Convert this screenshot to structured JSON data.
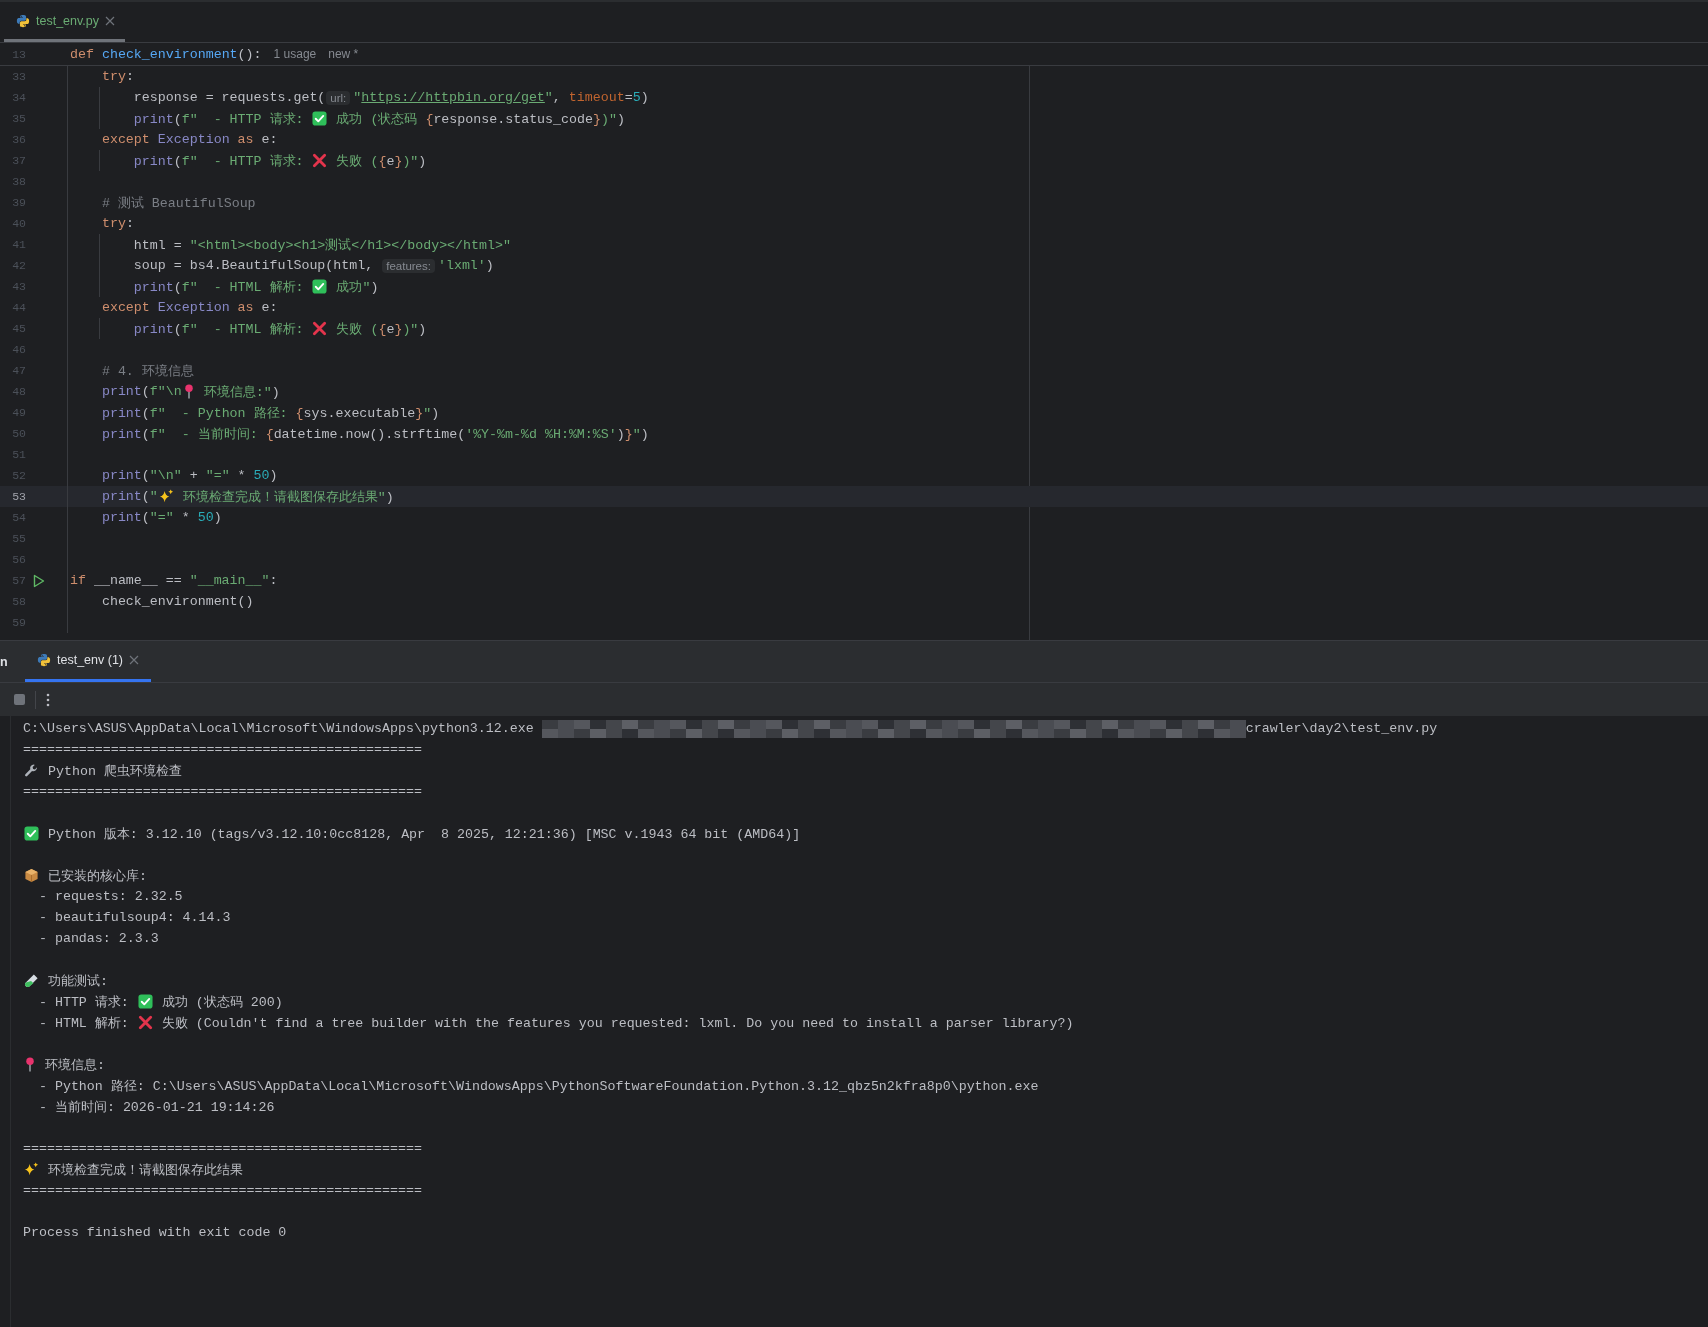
{
  "editor_tabs": [
    {
      "label": "test_env.py",
      "selected": true
    }
  ],
  "editor": {
    "sticky_line": {
      "no": "13",
      "parts": [
        {
          "kind": "code",
          "text": "def check_environment():"
        },
        {
          "kind": "lens",
          "text": "1 usage"
        },
        {
          "kind": "lens",
          "text": "new *"
        }
      ]
    },
    "lines": [
      {
        "no": "33",
        "current": false,
        "run": false,
        "parts": [
          {
            "kind": "code",
            "text": "    try:"
          }
        ]
      },
      {
        "no": "34",
        "current": false,
        "run": false,
        "parts": [
          {
            "kind": "code",
            "text": "        response = requests.get("
          },
          {
            "kind": "hint",
            "text": "url:"
          },
          {
            "kind": "code",
            "text": "\""
          },
          {
            "kind": "link",
            "text": "https://httpbin.org/get"
          },
          {
            "kind": "code",
            "text": "\", timeout=5)"
          }
        ]
      },
      {
        "no": "35",
        "current": false,
        "run": false,
        "parts": [
          {
            "kind": "code",
            "text": "        print(f\"  - HTTP 请求: "
          },
          {
            "kind": "check"
          },
          {
            "kind": "code",
            "text": " 成功 (状态码 {response.status_code})\")"
          }
        ]
      },
      {
        "no": "36",
        "current": false,
        "run": false,
        "parts": [
          {
            "kind": "code",
            "text": "    except Exception as e:"
          }
        ]
      },
      {
        "no": "37",
        "current": false,
        "run": false,
        "parts": [
          {
            "kind": "code",
            "text": "        print(f\"  - HTTP 请求: "
          },
          {
            "kind": "cross"
          },
          {
            "kind": "code",
            "text": " 失败 ({e})\")"
          }
        ]
      },
      {
        "no": "38",
        "current": false,
        "run": false
      },
      {
        "no": "39",
        "current": false,
        "run": false,
        "parts": [
          {
            "kind": "code",
            "text": "    # 测试 BeautifulSoup"
          }
        ]
      },
      {
        "no": "40",
        "current": false,
        "run": false,
        "parts": [
          {
            "kind": "code",
            "text": "    try:"
          }
        ]
      },
      {
        "no": "41",
        "current": false,
        "run": false,
        "parts": [
          {
            "kind": "code",
            "text": "        html = \"<html><body><h1>测试</h1></body></html>\""
          }
        ]
      },
      {
        "no": "42",
        "current": false,
        "run": false,
        "parts": [
          {
            "kind": "code",
            "text": "        soup = bs4.BeautifulSoup(html, "
          },
          {
            "kind": "hint",
            "text": "features:"
          },
          {
            "kind": "code",
            "text": "'lxml')"
          }
        ]
      },
      {
        "no": "43",
        "current": false,
        "run": false,
        "parts": [
          {
            "kind": "code",
            "text": "        print(f\"  - HTML 解析: "
          },
          {
            "kind": "check"
          },
          {
            "kind": "code",
            "text": " 成功\")"
          }
        ]
      },
      {
        "no": "44",
        "current": false,
        "run": false,
        "parts": [
          {
            "kind": "code",
            "text": "    except Exception as e:"
          }
        ]
      },
      {
        "no": "45",
        "current": false,
        "run": false,
        "parts": [
          {
            "kind": "code",
            "text": "        print(f\"  - HTML 解析: "
          },
          {
            "kind": "cross"
          },
          {
            "kind": "code",
            "text": " 失败 ({e})\")"
          }
        ]
      },
      {
        "no": "46",
        "current": false,
        "run": false
      },
      {
        "no": "47",
        "current": false,
        "run": false,
        "parts": [
          {
            "kind": "code",
            "text": "    # 4. 环境信息"
          }
        ]
      },
      {
        "no": "48",
        "current": false,
        "run": false,
        "parts": [
          {
            "kind": "code",
            "text": "    print(f\"\\n"
          },
          {
            "kind": "pin"
          },
          {
            "kind": "code",
            "text": " 环境信息:\")"
          }
        ]
      },
      {
        "no": "49",
        "current": false,
        "run": false,
        "parts": [
          {
            "kind": "code",
            "text": "    print(f\"  - Python 路径: {sys.executable}\")"
          }
        ]
      },
      {
        "no": "50",
        "current": false,
        "run": false,
        "parts": [
          {
            "kind": "code",
            "text": "    print(f\"  - 当前时间: {datetime.now().strftime('%Y-%m-%d %H:%M:%S')}\")"
          }
        ]
      },
      {
        "no": "51",
        "current": false,
        "run": false
      },
      {
        "no": "52",
        "current": false,
        "run": false,
        "parts": [
          {
            "kind": "code",
            "text": "    print(\"\\n\" + \"=\" * 50)"
          }
        ]
      },
      {
        "no": "53",
        "current": true,
        "run": false,
        "parts": [
          {
            "kind": "code",
            "text": "    print(\""
          },
          {
            "kind": "sparkle"
          },
          {
            "kind": "code",
            "text": " 环境检查完成！请截图保存此结果\")"
          }
        ]
      },
      {
        "no": "54",
        "current": false,
        "run": false,
        "parts": [
          {
            "kind": "code",
            "text": "    print(\"=\" * 50)"
          }
        ]
      },
      {
        "no": "55",
        "current": false,
        "run": false
      },
      {
        "no": "56",
        "current": false,
        "run": false
      },
      {
        "no": "57",
        "current": false,
        "run": true,
        "parts": [
          {
            "kind": "code",
            "text": "if __name__ == \"__main__\":"
          }
        ]
      },
      {
        "no": "58",
        "current": false,
        "run": false,
        "parts": [
          {
            "kind": "code",
            "text": "    check_environment()"
          }
        ]
      },
      {
        "no": "59",
        "current": false,
        "run": false
      }
    ]
  },
  "panel": {
    "cut_label": "n",
    "tabs": [
      {
        "label": "test_env (1)",
        "selected": true
      }
    ]
  },
  "console": {
    "blocks": [
      {
        "lines": [
          {
            "parts": [
              {
                "kind": "output",
                "text": "C:\\Users\\ASUS\\AppData\\Local\\Microsoft\\WindowsApps\\python3.12.exe"
              },
              {
                "kind": "redacted"
              },
              {
                "kind": "output",
                "text": "crawler\\day2\\test_env.py"
              }
            ]
          },
          {
            "parts": [
              {
                "kind": "output",
                "text": "=================================================="
              }
            ]
          },
          {
            "parts": [
              {
                "kind": "wrench"
              },
              {
                "kind": "output",
                "text": " Python 爬虫环境检查"
              }
            ]
          },
          {
            "parts": [
              {
                "kind": "output",
                "text": "=================================================="
              }
            ]
          }
        ]
      },
      {
        "lines": [
          {
            "parts": [
              {
                "kind": "check"
              },
              {
                "kind": "output",
                "text": " Python 版本: 3.12.10 (tags/v3.12.10:0cc8128, Apr  8 2025, 12:21:36) [MSC v.1943 64 bit (AMD64)]"
              }
            ]
          }
        ]
      },
      {
        "lines": [
          {
            "parts": [
              {
                "kind": "box"
              },
              {
                "kind": "output",
                "text": " 已安装的核心库:"
              }
            ]
          },
          {
            "parts": [
              {
                "kind": "output",
                "text": "  - requests: 2.32.5"
              }
            ]
          },
          {
            "parts": [
              {
                "kind": "output",
                "text": "  - beautifulsoup4: 4.14.3"
              }
            ]
          },
          {
            "parts": [
              {
                "kind": "output",
                "text": "  - pandas: 2.3.3"
              }
            ]
          }
        ]
      },
      {
        "lines": [
          {
            "parts": [
              {
                "kind": "tube"
              },
              {
                "kind": "output",
                "text": " 功能测试:"
              }
            ]
          },
          {
            "parts": [
              {
                "kind": "output",
                "text": "  - HTTP 请求: "
              },
              {
                "kind": "check"
              },
              {
                "kind": "output",
                "text": " 成功 (状态码 200)"
              }
            ]
          },
          {
            "parts": [
              {
                "kind": "output",
                "text": "  - HTML 解析: "
              },
              {
                "kind": "cross"
              },
              {
                "kind": "output",
                "text": " 失败 (Couldn't find a tree builder with the features you requested: lxml. Do you need to install a parser library?)"
              }
            ]
          }
        ]
      },
      {
        "lines": [
          {
            "parts": [
              {
                "kind": "pin"
              },
              {
                "kind": "output",
                "text": " 环境信息:"
              }
            ]
          },
          {
            "parts": [
              {
                "kind": "output",
                "text": "  - Python 路径: C:\\Users\\ASUS\\AppData\\Local\\Microsoft\\WindowsApps\\PythonSoftwareFoundation.Python.3.12_qbz5n2kfra8p0\\python.exe"
              }
            ]
          },
          {
            "parts": [
              {
                "kind": "output",
                "text": "  - 当前时间: 2026-01-21 19:14:26"
              }
            ]
          }
        ]
      },
      {
        "lines": [
          {
            "parts": [
              {
                "kind": "output",
                "text": "=================================================="
              }
            ]
          },
          {
            "parts": [
              {
                "kind": "sparkle"
              },
              {
                "kind": "output",
                "text": " 环境检查完成！请截图保存此结果"
              }
            ]
          },
          {
            "parts": [
              {
                "kind": "output",
                "text": "=================================================="
              }
            ]
          }
        ]
      },
      {
        "lines": [
          {
            "parts": [
              {
                "kind": "output",
                "text": "Process finished with exit code 0"
              }
            ]
          }
        ]
      }
    ]
  }
}
